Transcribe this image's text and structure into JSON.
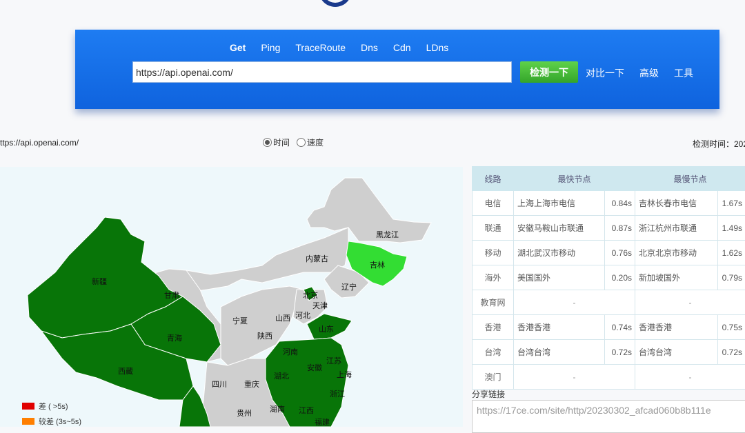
{
  "nav": {
    "tabs": [
      "Get",
      "Ping",
      "TraceRoute",
      "Dns",
      "Cdn",
      "LDns"
    ],
    "active_tab": "Get"
  },
  "search": {
    "url_value": "https://api.openai.com/",
    "detect_label": "检测一下",
    "compare_label": "对比一下",
    "advanced_label": "高级",
    "tools_label": "工具"
  },
  "info": {
    "url": "ttps://api.openai.com/",
    "mode_time": "时间",
    "mode_speed": "速度",
    "selected_mode": "时间",
    "check_time_label": "检测时间：202"
  },
  "map": {
    "provinces": [
      "黑龙江",
      "吉林",
      "内蒙古",
      "辽宁",
      "北京",
      "天津",
      "甘肃",
      "新疆",
      "宁夏",
      "山西",
      "河北",
      "山东",
      "陕西",
      "青海",
      "西藏",
      "河南",
      "安徽",
      "江苏",
      "湖北",
      "上海",
      "四川",
      "重庆",
      "浙江",
      "湖南",
      "江西",
      "贵州",
      "福建"
    ],
    "colors": {
      "dark_green": "#087508",
      "light_green": "#33dd33",
      "gray": "#cfcfcf",
      "background": "#eef8fb"
    },
    "legend": [
      {
        "label": "差 ( >5s)",
        "color": "#e00000"
      },
      {
        "label": "较差 (3s~5s)",
        "color": "#ff7f00"
      }
    ]
  },
  "table": {
    "headers": [
      "线路",
      "最快节点",
      "最慢节点"
    ],
    "rows": [
      {
        "route": "电信",
        "fast_node": "上海上海市电信",
        "fast_time": "0.84s",
        "slow_node": "吉林长春市电信",
        "slow_time": "1.67s"
      },
      {
        "route": "联通",
        "fast_node": "安徽马鞍山市联通",
        "fast_time": "0.87s",
        "slow_node": "浙江杭州市联通",
        "slow_time": "1.49s"
      },
      {
        "route": "移动",
        "fast_node": "湖北武汉市移动",
        "fast_time": "0.76s",
        "slow_node": "北京北京市移动",
        "slow_time": "1.62s"
      },
      {
        "route": "海外",
        "fast_node": "美国国外",
        "fast_time": "0.20s",
        "slow_node": "新加坡国外",
        "slow_time": "0.79s"
      },
      {
        "route": "教育网",
        "fast_node": "-",
        "fast_time": "",
        "slow_node": "-",
        "slow_time": ""
      },
      {
        "route": "香港",
        "fast_node": "香港香港",
        "fast_time": "0.74s",
        "slow_node": "香港香港",
        "slow_time": "0.75s"
      },
      {
        "route": "台湾",
        "fast_node": "台湾台湾",
        "fast_time": "0.72s",
        "slow_node": "台湾台湾",
        "slow_time": "0.72s"
      },
      {
        "route": "澳门",
        "fast_node": "-",
        "fast_time": "",
        "slow_node": "-",
        "slow_time": ""
      }
    ]
  },
  "share": {
    "label": "分享链接",
    "url": "https://17ce.com/site/http/20230302_afcad060b8b111e"
  }
}
